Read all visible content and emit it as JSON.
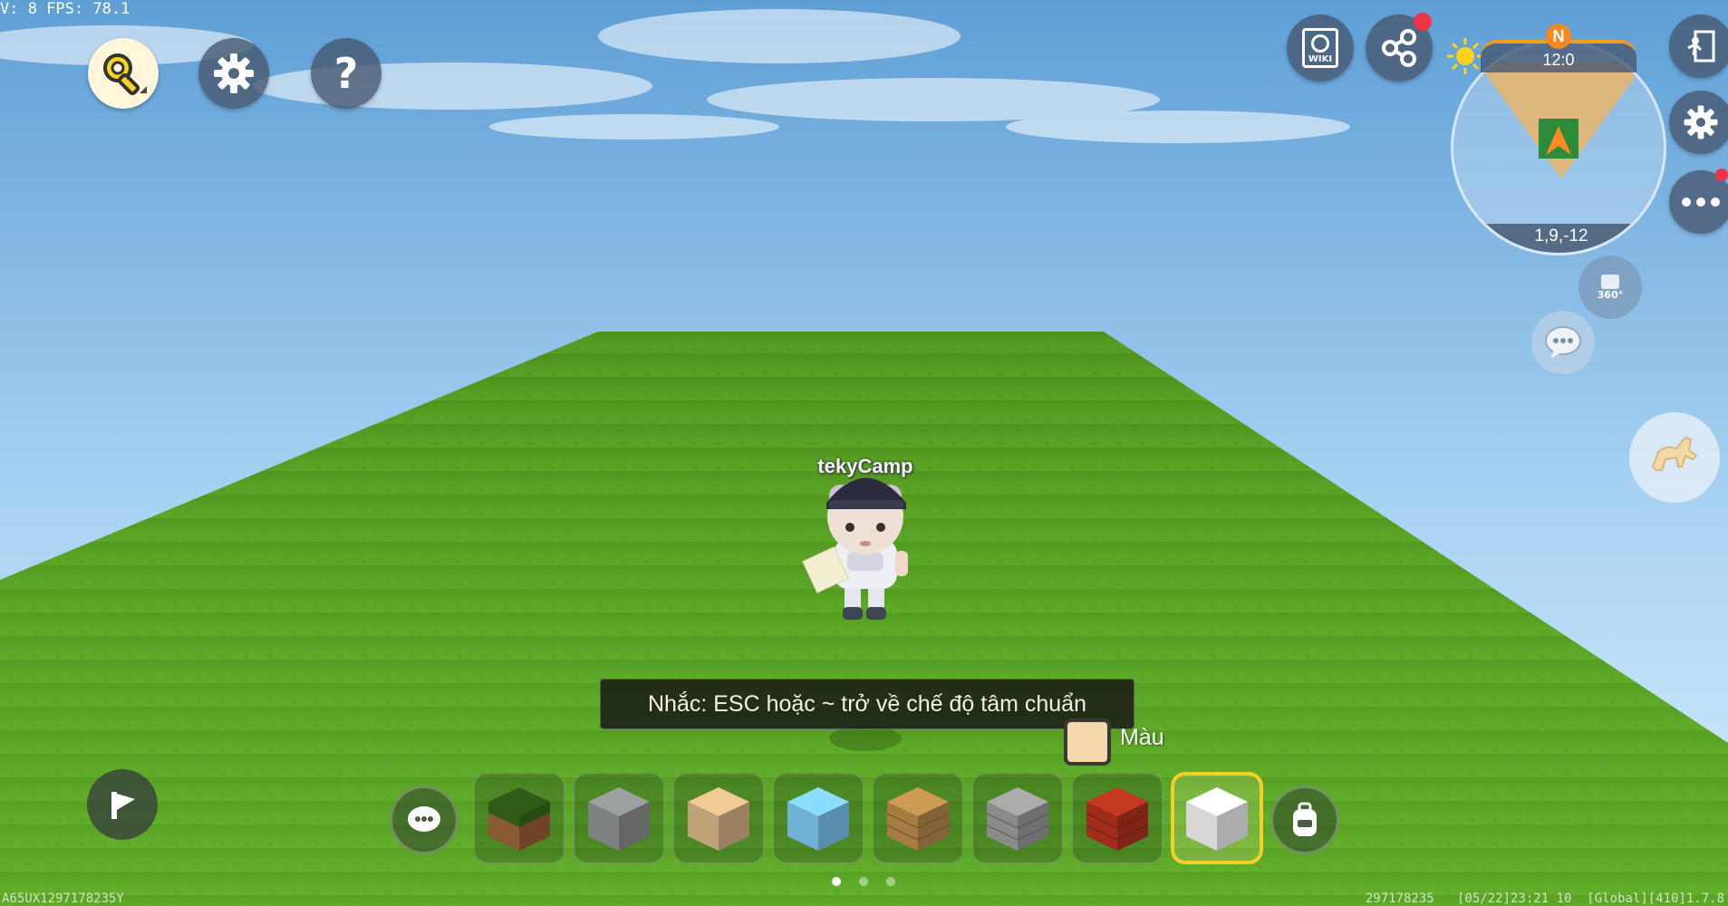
{
  "hud": {
    "fps_text": "V: 8 FPS: 78.1",
    "player_name": "tekyCamp",
    "hint": "Nhắc: ESC hoặc ~ trở về chế độ tâm chuẩn",
    "color_label": "Màu",
    "bottom_left_id": "A65UX1297178235Y",
    "bottom_right_info": "297178235   [05/22]23:21 10  [Global][410]1.7.8"
  },
  "minimap": {
    "compass": "N",
    "time": "12:0",
    "coords": "1,9,-12"
  },
  "top_right": {
    "wiki_label": "WIKI",
    "view_label": "360°"
  },
  "hotbar": {
    "selected_index": 7,
    "items": [
      {
        "icon": "grass-block-icon",
        "color": "#3c6b1f"
      },
      {
        "icon": "stone-block-icon",
        "color": "#8c8f8f"
      },
      {
        "icon": "sand-block-icon",
        "color": "#d6b586"
      },
      {
        "icon": "ice-block-icon",
        "color": "#7cc6ef"
      },
      {
        "icon": "wood-planks-icon",
        "color": "#b88a4b"
      },
      {
        "icon": "stone-brick-icon",
        "color": "#9a9a9a"
      },
      {
        "icon": "red-brick-icon",
        "color": "#b2321f"
      },
      {
        "icon": "white-block-icon",
        "color": "#efefef"
      }
    ]
  },
  "pagination": {
    "pages": 3,
    "active": 0
  },
  "colors": {
    "accent": "#f4cf2a",
    "grass": "#5aa324",
    "sky_top": "#6aa7d8",
    "sky_bottom": "#cfe8fb",
    "notification": "#ee3344"
  }
}
